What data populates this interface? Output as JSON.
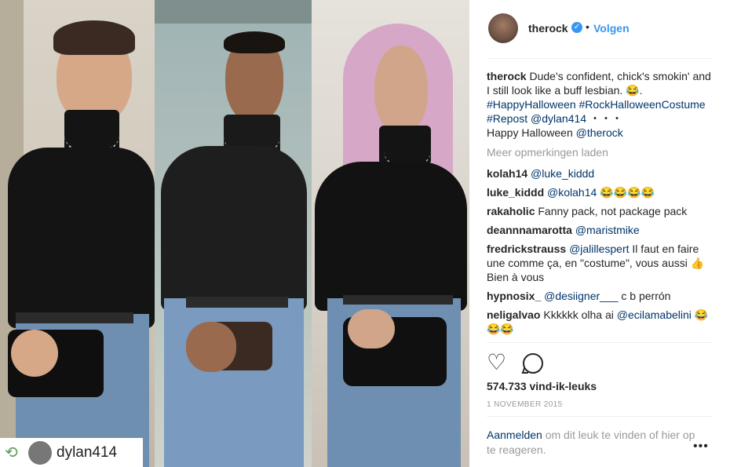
{
  "header": {
    "username": "therock",
    "verified_icon": "verified-badge-icon",
    "dot": "•",
    "follow_label": "Volgen"
  },
  "caption": {
    "author": "therock",
    "text": "Dude's confident, chick's smokin' and I still look like a buff lesbian. 😂.",
    "hashtags": "#HappyHalloween #RockHalloweenCostume",
    "repost_line": "#Repost @dylan414",
    "ellipsis": "・・・",
    "greeting": "Happy Halloween",
    "mention": "@therock"
  },
  "load_more": "Meer opmerkingen laden",
  "comments": [
    {
      "user": "kolah14",
      "text": "",
      "mention": "@luke_kiddd",
      "after": ""
    },
    {
      "user": "luke_kiddd",
      "text": "",
      "mention": "@kolah14",
      "after": " 😂😂😂😂"
    },
    {
      "user": "rakaholic",
      "text": "Fanny pack, not package pack",
      "mention": "",
      "after": ""
    },
    {
      "user": "deannnamarotta",
      "text": "",
      "mention": "@maristmike",
      "after": ""
    },
    {
      "user": "fredrickstrauss",
      "text": "",
      "mention": "@jalillespert",
      "after": " Il faut en faire une comme ça, en \"costume\", vous aussi 👍 Bien à vous"
    },
    {
      "user": "hypnosix_",
      "text": "",
      "mention": "@desiigner___",
      "after": " c b perrón"
    },
    {
      "user": "neligalvao",
      "text": "Kkkkkk olha ai ",
      "mention": "@ecilamabelini",
      "after": " 😂😂😂"
    }
  ],
  "actions": {
    "like_icon": "heart-icon",
    "comment_icon": "comment-bubble-icon"
  },
  "likes": "574.733 vind-ik-leuks",
  "date": "1 NOVEMBER 2015",
  "login": {
    "link": "Aanmelden",
    "text": " om dit leuk te vinden of hier op te reageren."
  },
  "more_menu": "•••",
  "repost_badge": {
    "icon": "repost-icon",
    "name": "dylan414"
  }
}
